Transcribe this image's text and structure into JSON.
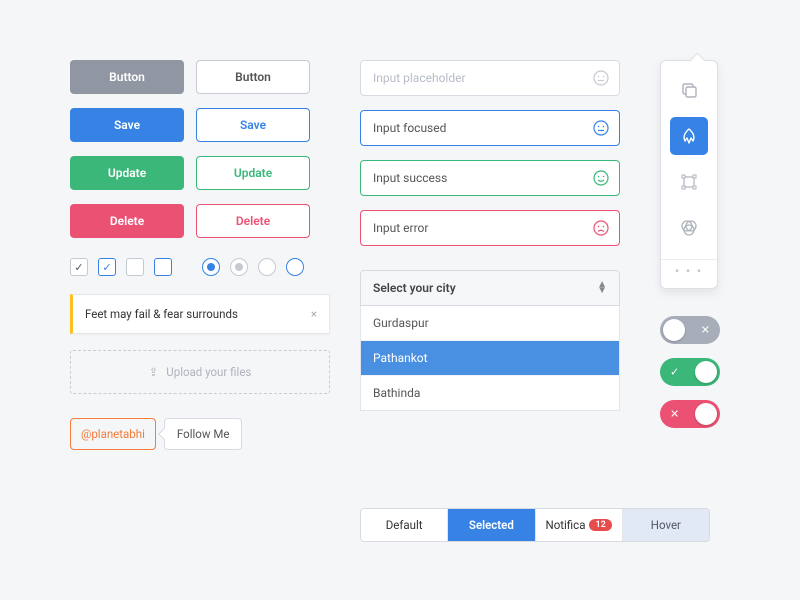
{
  "buttons": {
    "default": "Button",
    "save": "Save",
    "update": "Update",
    "delete": "Delete"
  },
  "alert": {
    "text": "Feet may fail & fear surrounds",
    "close": "×"
  },
  "upload": {
    "label": "Upload your files"
  },
  "social": {
    "handle": "@planetabhi",
    "follow": "Follow Me"
  },
  "inputs": {
    "placeholder": "Input placeholder",
    "focused": "Input focused",
    "success": "Input success",
    "error": "Input error"
  },
  "select": {
    "label": "Select your city",
    "options": [
      "Gurdaspur",
      "Pathankot",
      "Bathinda"
    ],
    "selected_index": 1
  },
  "tabs": {
    "default": "Default",
    "selected": "Selected",
    "notify": "Notifica",
    "badge": "12",
    "hover": "Hover"
  },
  "toolbar": {
    "items": [
      "layers-icon",
      "pen-icon",
      "transform-icon",
      "filters-icon"
    ],
    "active_index": 1
  },
  "toggles": {
    "off_mark": "✕",
    "on_mark": "✓"
  },
  "colors": {
    "blue": "#3683e5",
    "green": "#3bb779",
    "red": "#ea5173",
    "gray": "#9097a3",
    "orange": "#f47c3c",
    "yellow": "#fbbf24"
  }
}
